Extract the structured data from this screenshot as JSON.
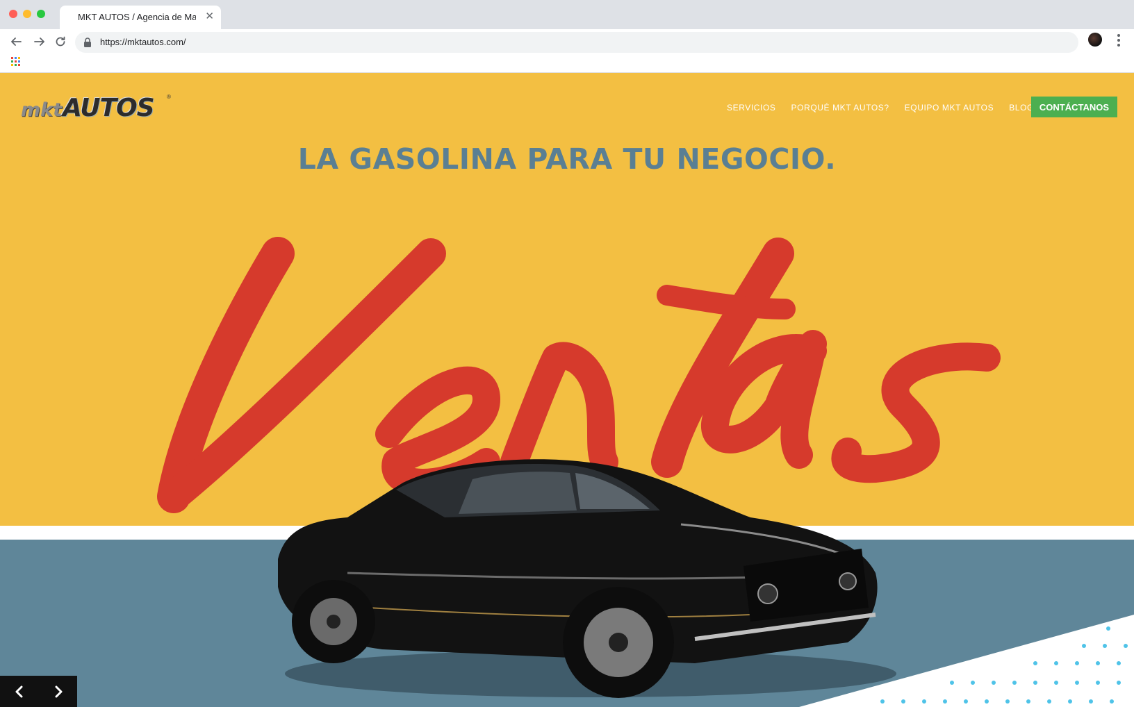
{
  "browser": {
    "tab_title": "MKT AUTOS / Agencia de Mar",
    "tab_close": "✕",
    "url": "https://mktautos.com/"
  },
  "site": {
    "logo_mkt": "mkt",
    "logo_autos": "AUTOS",
    "logo_registered": "®",
    "nav": {
      "servicios": "SERVICIOS",
      "porque": "PORQUÉ MKT AUTOS?",
      "equipo": "EQUIPO MKT AUTOS",
      "blog": "BLOG"
    },
    "cta": "CONTÁCTANOS",
    "headline": "LA GASOLINA PARA TU NEGOCIO.",
    "hero_script": "Ventas",
    "colors": {
      "hero_yellow": "#f3bf42",
      "hero_blue": "#5f8699",
      "script_red": "#d63a2c",
      "cta_green": "#4caf50",
      "headline_blue": "#5a7f93"
    },
    "slider": {
      "prev_icon": "chevron-left-icon",
      "next_icon": "chevron-right-icon"
    }
  }
}
